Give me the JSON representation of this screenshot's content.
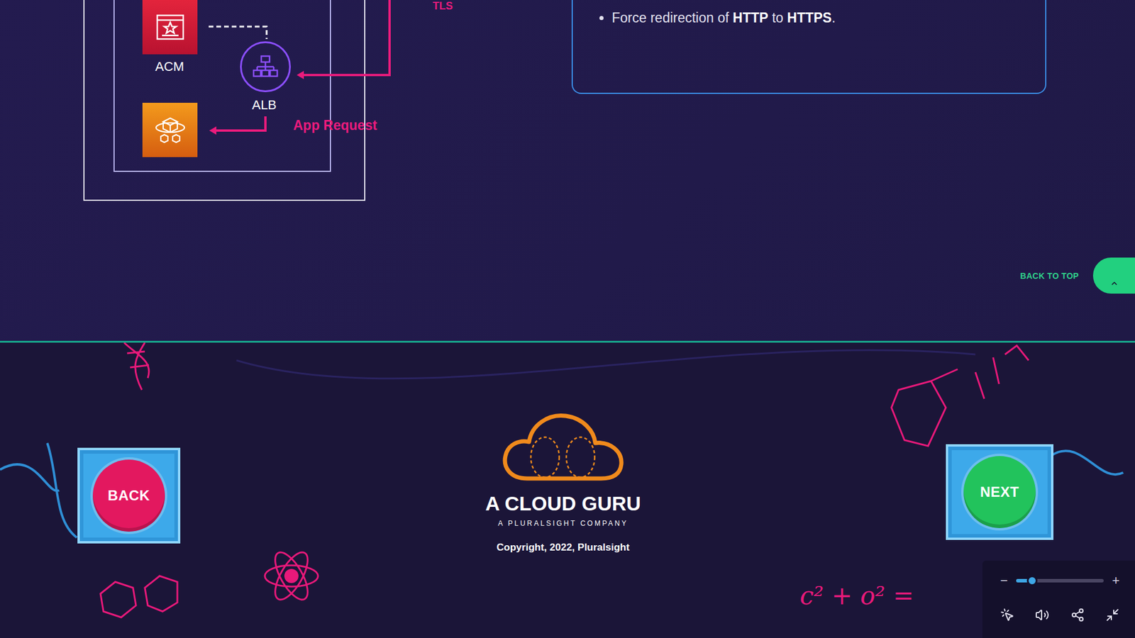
{
  "diagram": {
    "tls_label": "TLS",
    "acm_label": "ACM",
    "alb_label": "ALB",
    "edge_label": "App Request"
  },
  "info_box": {
    "bullets": [
      {
        "segments": [
          {
            "text": "Force redirection of ",
            "bold": false
          },
          {
            "text": "HTTP",
            "bold": true
          },
          {
            "text": " to ",
            "bold": false
          },
          {
            "text": "HTTPS",
            "bold": true
          },
          {
            "text": ".",
            "bold": false
          }
        ]
      }
    ]
  },
  "back_to_top": {
    "label": "BACK TO TOP"
  },
  "footer": {
    "back": "BACK",
    "next": "NEXT",
    "brand": "A CLOUD GURU",
    "tagline": "A PLURALSIGHT COMPANY",
    "copyright": "Copyright, 2022, Pluralsight",
    "doodle_formula": "c² + o² ="
  },
  "player_controls": {
    "zoom": {
      "minus": "−",
      "plus": "+",
      "level": 0.18
    }
  }
}
